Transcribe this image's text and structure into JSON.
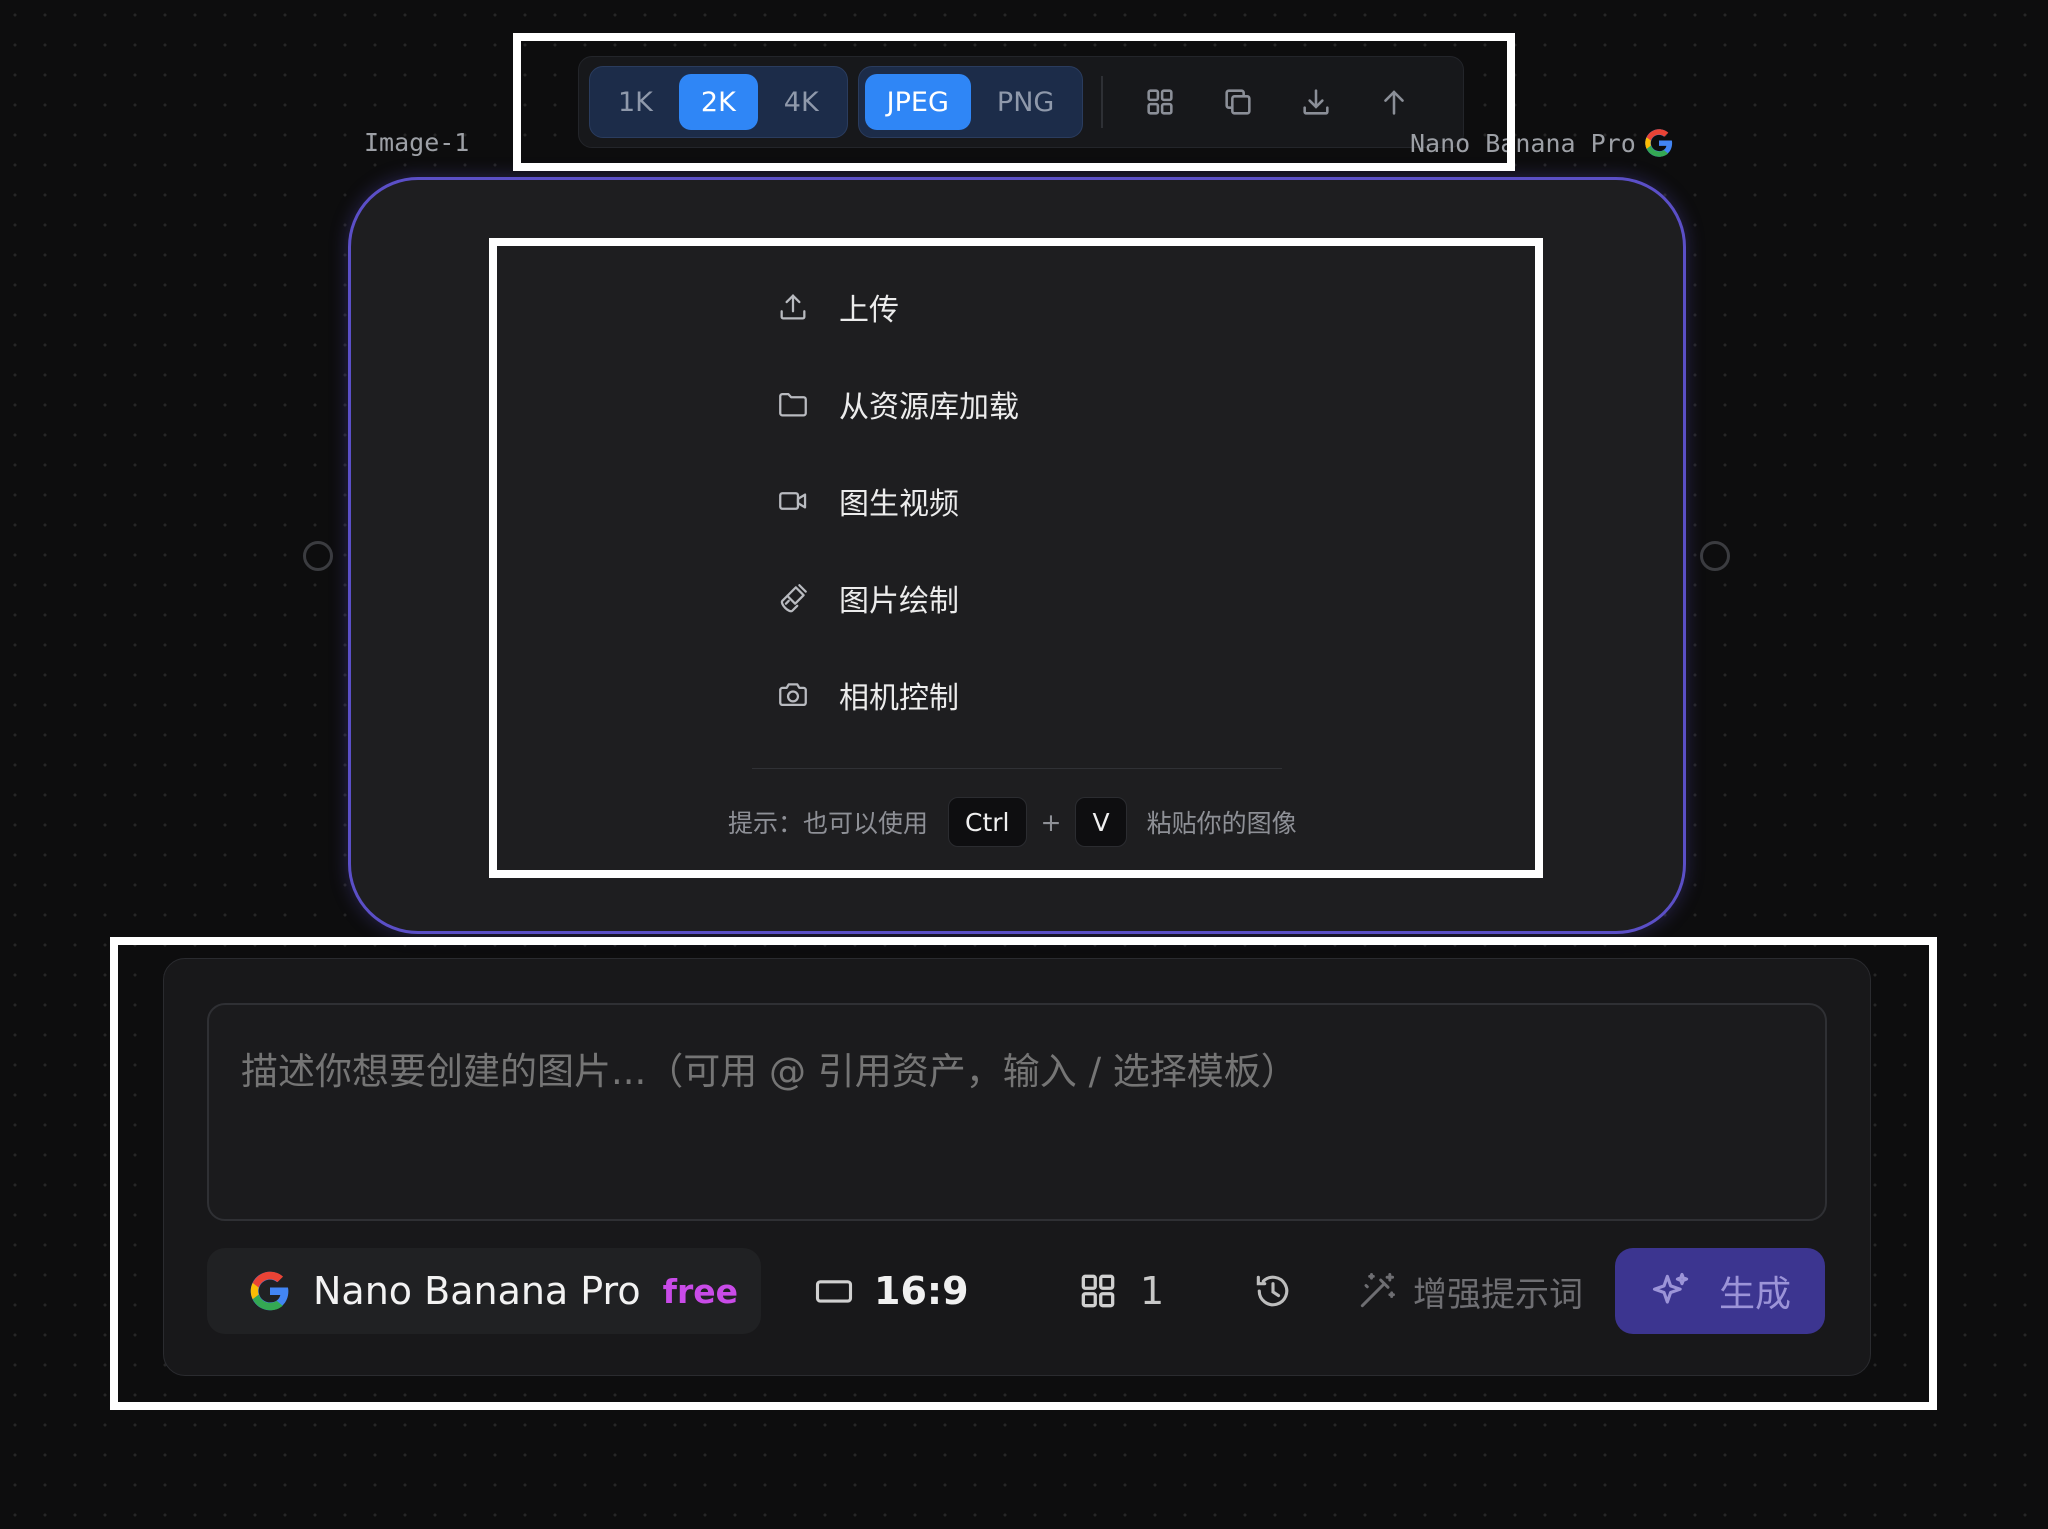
{
  "toolbar": {
    "resolution_options": [
      "1K",
      "2K",
      "4K"
    ],
    "resolution_selected": "2K",
    "format_options": [
      "JPEG",
      "PNG"
    ],
    "format_selected": "JPEG",
    "icons": [
      "grid-icon",
      "copy-icon",
      "download-icon",
      "arrow-up-icon"
    ]
  },
  "node": {
    "label": "Image-1",
    "model_label": "Nano Banana Pro",
    "menu": [
      {
        "icon": "upload-icon",
        "label": "上传"
      },
      {
        "icon": "folder-icon",
        "label": "从资源库加载"
      },
      {
        "icon": "video-camera-icon",
        "label": "图生视频"
      },
      {
        "icon": "paint-brush-icon",
        "label": "图片绘制"
      },
      {
        "icon": "camera-icon",
        "label": "相机控制"
      }
    ],
    "hint": {
      "prefix": "提示：也可以使用",
      "key1": "Ctrl",
      "plus": "+",
      "key2": "V",
      "suffix": "粘贴你的图像"
    }
  },
  "prompt": {
    "placeholder": "描述你想要创建的图片...（可用 @ 引用资产，输入 / 选择模板）",
    "model_name": "Nano Banana Pro",
    "model_badge": "free",
    "aspect_ratio": "16:9",
    "count": "1",
    "enhance_label": "增强提示词",
    "generate_label": "生成"
  },
  "colors": {
    "accent_blue": "#2f86f6",
    "card_border": "#5b4fc7",
    "generate_button": "#3c3590",
    "free_badge": "#c94be8"
  }
}
